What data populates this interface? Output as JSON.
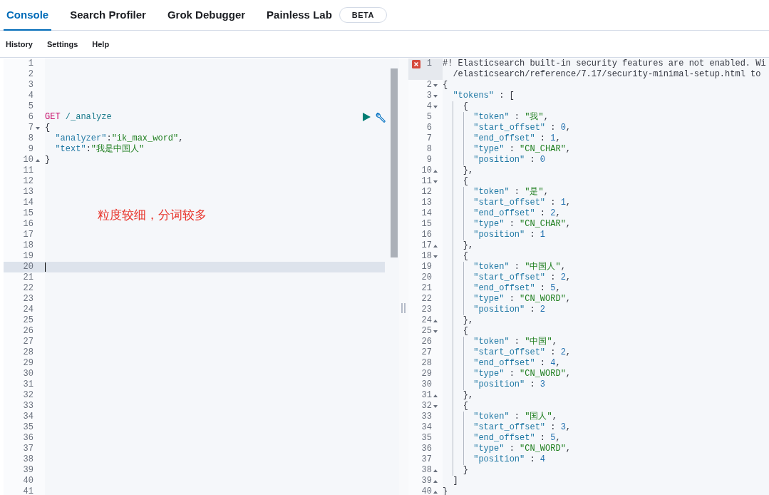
{
  "tabs": [
    {
      "label": "Console",
      "selected": true
    },
    {
      "label": "Search Profiler",
      "selected": false
    },
    {
      "label": "Grok Debugger",
      "selected": false
    },
    {
      "label": "Painless Lab",
      "selected": false,
      "badge": "BETA"
    }
  ],
  "menu": [
    "History",
    "Settings",
    "Help"
  ],
  "request_editor": {
    "annotation": "粒度较细，分词较多",
    "lines": [
      {
        "n": "1",
        "fold_start": false,
        "fold_end": false,
        "active": false,
        "actions": false
      },
      {
        "n": "2",
        "fold_start": false,
        "fold_end": false,
        "active": false,
        "actions": false
      },
      {
        "n": "3",
        "fold_start": false,
        "fold_end": false,
        "active": false,
        "actions": false
      },
      {
        "n": "4",
        "fold_start": false,
        "fold_end": false,
        "active": false,
        "actions": false
      },
      {
        "n": "5",
        "fold_start": false,
        "fold_end": false,
        "active": false,
        "actions": false
      },
      {
        "n": "6",
        "fold_start": false,
        "fold_end": false,
        "active": false,
        "actions": true,
        "tokens": [
          {
            "kind": "keyword",
            "text": "GET"
          },
          {
            "kind": "path",
            "text": " /_analyze"
          }
        ]
      },
      {
        "n": "7",
        "fold_start": true,
        "fold_end": false,
        "active": false,
        "actions": false,
        "tokens": [
          {
            "kind": "punct",
            "text": "{"
          }
        ]
      },
      {
        "n": "8",
        "fold_start": false,
        "fold_end": false,
        "active": false,
        "actions": false,
        "tokens": [
          {
            "kind": "key",
            "text": "  \"analyzer\""
          },
          {
            "kind": "punct",
            "text": ":"
          },
          {
            "kind": "string",
            "text": "\"ik_max_word\""
          },
          {
            "kind": "punct",
            "text": ","
          }
        ]
      },
      {
        "n": "9",
        "fold_start": false,
        "fold_end": false,
        "active": false,
        "actions": false,
        "tokens": [
          {
            "kind": "key",
            "text": "  \"text\""
          },
          {
            "kind": "punct",
            "text": ":"
          },
          {
            "kind": "string",
            "text": "\"我是中国人\""
          }
        ]
      },
      {
        "n": "10",
        "fold_start": false,
        "fold_end": true,
        "active": false,
        "actions": false,
        "tokens": [
          {
            "kind": "punct",
            "text": "}"
          }
        ]
      },
      {
        "n": "11",
        "fold_start": false,
        "fold_end": false,
        "active": false,
        "actions": false
      },
      {
        "n": "12",
        "fold_start": false,
        "fold_end": false,
        "active": false,
        "actions": false
      },
      {
        "n": "13",
        "fold_start": false,
        "fold_end": false,
        "active": false,
        "actions": false
      },
      {
        "n": "14",
        "fold_start": false,
        "fold_end": false,
        "active": false,
        "actions": false
      },
      {
        "n": "15",
        "fold_start": false,
        "fold_end": false,
        "active": false,
        "actions": false
      },
      {
        "n": "16",
        "fold_start": false,
        "fold_end": false,
        "active": false,
        "actions": false
      },
      {
        "n": "17",
        "fold_start": false,
        "fold_end": false,
        "active": false,
        "actions": false
      },
      {
        "n": "18",
        "fold_start": false,
        "fold_end": false,
        "active": false,
        "actions": false
      },
      {
        "n": "19",
        "fold_start": false,
        "fold_end": false,
        "active": false,
        "actions": false
      },
      {
        "n": "20",
        "fold_start": false,
        "fold_end": false,
        "active": true,
        "actions": false
      },
      {
        "n": "21",
        "fold_start": false,
        "fold_end": false,
        "active": false,
        "actions": false
      },
      {
        "n": "22",
        "fold_start": false,
        "fold_end": false,
        "active": false,
        "actions": false
      },
      {
        "n": "23",
        "fold_start": false,
        "fold_end": false,
        "active": false,
        "actions": false
      },
      {
        "n": "24",
        "fold_start": false,
        "fold_end": false,
        "active": false,
        "actions": false
      },
      {
        "n": "25",
        "fold_start": false,
        "fold_end": false,
        "active": false,
        "actions": false
      },
      {
        "n": "26",
        "fold_start": false,
        "fold_end": false,
        "active": false,
        "actions": false
      },
      {
        "n": "27",
        "fold_start": false,
        "fold_end": false,
        "active": false,
        "actions": false
      },
      {
        "n": "28",
        "fold_start": false,
        "fold_end": false,
        "active": false,
        "actions": false
      },
      {
        "n": "29",
        "fold_start": false,
        "fold_end": false,
        "active": false,
        "actions": false
      },
      {
        "n": "30",
        "fold_start": false,
        "fold_end": false,
        "active": false,
        "actions": false
      },
      {
        "n": "31",
        "fold_start": false,
        "fold_end": false,
        "active": false,
        "actions": false
      },
      {
        "n": "32",
        "fold_start": false,
        "fold_end": false,
        "active": false,
        "actions": false
      },
      {
        "n": "33",
        "fold_start": false,
        "fold_end": false,
        "active": false,
        "actions": false
      },
      {
        "n": "34",
        "fold_start": false,
        "fold_end": false,
        "active": false,
        "actions": false
      },
      {
        "n": "35",
        "fold_start": false,
        "fold_end": false,
        "active": false,
        "actions": false
      },
      {
        "n": "36",
        "fold_start": false,
        "fold_end": false,
        "active": false,
        "actions": false
      },
      {
        "n": "37",
        "fold_start": false,
        "fold_end": false,
        "active": false,
        "actions": false
      },
      {
        "n": "38",
        "fold_start": false,
        "fold_end": false,
        "active": false,
        "actions": false
      },
      {
        "n": "39",
        "fold_start": false,
        "fold_end": false,
        "active": false,
        "actions": false
      },
      {
        "n": "40",
        "fold_start": false,
        "fold_end": false,
        "active": false,
        "actions": false
      },
      {
        "n": "41",
        "fold_start": false,
        "fold_end": false,
        "active": false,
        "actions": false
      }
    ]
  },
  "response_editor": {
    "lines": [
      {
        "n": "1",
        "fold_start": false,
        "fold_end": false,
        "error": true,
        "tokens": [
          {
            "kind": "comment",
            "text": "#! Elasticsearch built-in security features are not enabled. Wi"
          }
        ],
        "continuation": "/elasticsearch/reference/7.17/security-minimal-setup.html to"
      },
      {
        "n": "2",
        "fold_start": true,
        "fold_end": false,
        "error": false,
        "tokens": [
          {
            "kind": "punct",
            "text": "{"
          }
        ]
      },
      {
        "n": "3",
        "fold_start": true,
        "fold_end": false,
        "error": false,
        "tokens": [
          {
            "kind": "key",
            "text": "  \"tokens\""
          },
          {
            "kind": "punct",
            "text": " : ["
          }
        ]
      },
      {
        "n": "4",
        "fold_start": true,
        "fold_end": false,
        "error": false,
        "tokens": [
          {
            "kind": "punct",
            "text": "    {"
          }
        ]
      },
      {
        "n": "5",
        "fold_start": false,
        "fold_end": false,
        "error": false,
        "tokens": [
          {
            "kind": "key",
            "text": "      \"token\""
          },
          {
            "kind": "punct",
            "text": " : "
          },
          {
            "kind": "string",
            "text": "\"我\""
          },
          {
            "kind": "punct",
            "text": ","
          }
        ]
      },
      {
        "n": "6",
        "fold_start": false,
        "fold_end": false,
        "error": false,
        "tokens": [
          {
            "kind": "key",
            "text": "      \"start_offset\""
          },
          {
            "kind": "punct",
            "text": " : "
          },
          {
            "kind": "number",
            "text": "0"
          },
          {
            "kind": "punct",
            "text": ","
          }
        ]
      },
      {
        "n": "7",
        "fold_start": false,
        "fold_end": false,
        "error": false,
        "tokens": [
          {
            "kind": "key",
            "text": "      \"end_offset\""
          },
          {
            "kind": "punct",
            "text": " : "
          },
          {
            "kind": "number",
            "text": "1"
          },
          {
            "kind": "punct",
            "text": ","
          }
        ]
      },
      {
        "n": "8",
        "fold_start": false,
        "fold_end": false,
        "error": false,
        "tokens": [
          {
            "kind": "key",
            "text": "      \"type\""
          },
          {
            "kind": "punct",
            "text": " : "
          },
          {
            "kind": "string",
            "text": "\"CN_CHAR\""
          },
          {
            "kind": "punct",
            "text": ","
          }
        ]
      },
      {
        "n": "9",
        "fold_start": false,
        "fold_end": false,
        "error": false,
        "tokens": [
          {
            "kind": "key",
            "text": "      \"position\""
          },
          {
            "kind": "punct",
            "text": " : "
          },
          {
            "kind": "number",
            "text": "0"
          }
        ]
      },
      {
        "n": "10",
        "fold_start": false,
        "fold_end": true,
        "error": false,
        "tokens": [
          {
            "kind": "punct",
            "text": "    },"
          }
        ]
      },
      {
        "n": "11",
        "fold_start": true,
        "fold_end": false,
        "error": false,
        "tokens": [
          {
            "kind": "punct",
            "text": "    {"
          }
        ]
      },
      {
        "n": "12",
        "fold_start": false,
        "fold_end": false,
        "error": false,
        "tokens": [
          {
            "kind": "key",
            "text": "      \"token\""
          },
          {
            "kind": "punct",
            "text": " : "
          },
          {
            "kind": "string",
            "text": "\"是\""
          },
          {
            "kind": "punct",
            "text": ","
          }
        ]
      },
      {
        "n": "13",
        "fold_start": false,
        "fold_end": false,
        "error": false,
        "tokens": [
          {
            "kind": "key",
            "text": "      \"start_offset\""
          },
          {
            "kind": "punct",
            "text": " : "
          },
          {
            "kind": "number",
            "text": "1"
          },
          {
            "kind": "punct",
            "text": ","
          }
        ]
      },
      {
        "n": "14",
        "fold_start": false,
        "fold_end": false,
        "error": false,
        "tokens": [
          {
            "kind": "key",
            "text": "      \"end_offset\""
          },
          {
            "kind": "punct",
            "text": " : "
          },
          {
            "kind": "number",
            "text": "2"
          },
          {
            "kind": "punct",
            "text": ","
          }
        ]
      },
      {
        "n": "15",
        "fold_start": false,
        "fold_end": false,
        "error": false,
        "tokens": [
          {
            "kind": "key",
            "text": "      \"type\""
          },
          {
            "kind": "punct",
            "text": " : "
          },
          {
            "kind": "string",
            "text": "\"CN_CHAR\""
          },
          {
            "kind": "punct",
            "text": ","
          }
        ]
      },
      {
        "n": "16",
        "fold_start": false,
        "fold_end": false,
        "error": false,
        "tokens": [
          {
            "kind": "key",
            "text": "      \"position\""
          },
          {
            "kind": "punct",
            "text": " : "
          },
          {
            "kind": "number",
            "text": "1"
          }
        ]
      },
      {
        "n": "17",
        "fold_start": false,
        "fold_end": true,
        "error": false,
        "tokens": [
          {
            "kind": "punct",
            "text": "    },"
          }
        ]
      },
      {
        "n": "18",
        "fold_start": true,
        "fold_end": false,
        "error": false,
        "tokens": [
          {
            "kind": "punct",
            "text": "    {"
          }
        ]
      },
      {
        "n": "19",
        "fold_start": false,
        "fold_end": false,
        "error": false,
        "tokens": [
          {
            "kind": "key",
            "text": "      \"token\""
          },
          {
            "kind": "punct",
            "text": " : "
          },
          {
            "kind": "string",
            "text": "\"中国人\""
          },
          {
            "kind": "punct",
            "text": ","
          }
        ]
      },
      {
        "n": "20",
        "fold_start": false,
        "fold_end": false,
        "error": false,
        "tokens": [
          {
            "kind": "key",
            "text": "      \"start_offset\""
          },
          {
            "kind": "punct",
            "text": " : "
          },
          {
            "kind": "number",
            "text": "2"
          },
          {
            "kind": "punct",
            "text": ","
          }
        ]
      },
      {
        "n": "21",
        "fold_start": false,
        "fold_end": false,
        "error": false,
        "tokens": [
          {
            "kind": "key",
            "text": "      \"end_offset\""
          },
          {
            "kind": "punct",
            "text": " : "
          },
          {
            "kind": "number",
            "text": "5"
          },
          {
            "kind": "punct",
            "text": ","
          }
        ]
      },
      {
        "n": "22",
        "fold_start": false,
        "fold_end": false,
        "error": false,
        "tokens": [
          {
            "kind": "key",
            "text": "      \"type\""
          },
          {
            "kind": "punct",
            "text": " : "
          },
          {
            "kind": "string",
            "text": "\"CN_WORD\""
          },
          {
            "kind": "punct",
            "text": ","
          }
        ]
      },
      {
        "n": "23",
        "fold_start": false,
        "fold_end": false,
        "error": false,
        "tokens": [
          {
            "kind": "key",
            "text": "      \"position\""
          },
          {
            "kind": "punct",
            "text": " : "
          },
          {
            "kind": "number",
            "text": "2"
          }
        ]
      },
      {
        "n": "24",
        "fold_start": false,
        "fold_end": true,
        "error": false,
        "tokens": [
          {
            "kind": "punct",
            "text": "    },"
          }
        ]
      },
      {
        "n": "25",
        "fold_start": true,
        "fold_end": false,
        "error": false,
        "tokens": [
          {
            "kind": "punct",
            "text": "    {"
          }
        ]
      },
      {
        "n": "26",
        "fold_start": false,
        "fold_end": false,
        "error": false,
        "tokens": [
          {
            "kind": "key",
            "text": "      \"token\""
          },
          {
            "kind": "punct",
            "text": " : "
          },
          {
            "kind": "string",
            "text": "\"中国\""
          },
          {
            "kind": "punct",
            "text": ","
          }
        ]
      },
      {
        "n": "27",
        "fold_start": false,
        "fold_end": false,
        "error": false,
        "tokens": [
          {
            "kind": "key",
            "text": "      \"start_offset\""
          },
          {
            "kind": "punct",
            "text": " : "
          },
          {
            "kind": "number",
            "text": "2"
          },
          {
            "kind": "punct",
            "text": ","
          }
        ]
      },
      {
        "n": "28",
        "fold_start": false,
        "fold_end": false,
        "error": false,
        "tokens": [
          {
            "kind": "key",
            "text": "      \"end_offset\""
          },
          {
            "kind": "punct",
            "text": " : "
          },
          {
            "kind": "number",
            "text": "4"
          },
          {
            "kind": "punct",
            "text": ","
          }
        ]
      },
      {
        "n": "29",
        "fold_start": false,
        "fold_end": false,
        "error": false,
        "tokens": [
          {
            "kind": "key",
            "text": "      \"type\""
          },
          {
            "kind": "punct",
            "text": " : "
          },
          {
            "kind": "string",
            "text": "\"CN_WORD\""
          },
          {
            "kind": "punct",
            "text": ","
          }
        ]
      },
      {
        "n": "30",
        "fold_start": false,
        "fold_end": false,
        "error": false,
        "tokens": [
          {
            "kind": "key",
            "text": "      \"position\""
          },
          {
            "kind": "punct",
            "text": " : "
          },
          {
            "kind": "number",
            "text": "3"
          }
        ]
      },
      {
        "n": "31",
        "fold_start": false,
        "fold_end": true,
        "error": false,
        "tokens": [
          {
            "kind": "punct",
            "text": "    },"
          }
        ]
      },
      {
        "n": "32",
        "fold_start": true,
        "fold_end": false,
        "error": false,
        "tokens": [
          {
            "kind": "punct",
            "text": "    {"
          }
        ]
      },
      {
        "n": "33",
        "fold_start": false,
        "fold_end": false,
        "error": false,
        "tokens": [
          {
            "kind": "key",
            "text": "      \"token\""
          },
          {
            "kind": "punct",
            "text": " : "
          },
          {
            "kind": "string",
            "text": "\"国人\""
          },
          {
            "kind": "punct",
            "text": ","
          }
        ]
      },
      {
        "n": "34",
        "fold_start": false,
        "fold_end": false,
        "error": false,
        "tokens": [
          {
            "kind": "key",
            "text": "      \"start_offset\""
          },
          {
            "kind": "punct",
            "text": " : "
          },
          {
            "kind": "number",
            "text": "3"
          },
          {
            "kind": "punct",
            "text": ","
          }
        ]
      },
      {
        "n": "35",
        "fold_start": false,
        "fold_end": false,
        "error": false,
        "tokens": [
          {
            "kind": "key",
            "text": "      \"end_offset\""
          },
          {
            "kind": "punct",
            "text": " : "
          },
          {
            "kind": "number",
            "text": "5"
          },
          {
            "kind": "punct",
            "text": ","
          }
        ]
      },
      {
        "n": "36",
        "fold_start": false,
        "fold_end": false,
        "error": false,
        "tokens": [
          {
            "kind": "key",
            "text": "      \"type\""
          },
          {
            "kind": "punct",
            "text": " : "
          },
          {
            "kind": "string",
            "text": "\"CN_WORD\""
          },
          {
            "kind": "punct",
            "text": ","
          }
        ]
      },
      {
        "n": "37",
        "fold_start": false,
        "fold_end": false,
        "error": false,
        "tokens": [
          {
            "kind": "key",
            "text": "      \"position\""
          },
          {
            "kind": "punct",
            "text": " : "
          },
          {
            "kind": "number",
            "text": "4"
          }
        ]
      },
      {
        "n": "38",
        "fold_start": false,
        "fold_end": true,
        "error": false,
        "tokens": [
          {
            "kind": "punct",
            "text": "    }"
          }
        ]
      },
      {
        "n": "39",
        "fold_start": false,
        "fold_end": true,
        "error": false,
        "tokens": [
          {
            "kind": "punct",
            "text": "  ]"
          }
        ]
      },
      {
        "n": "40",
        "fold_start": false,
        "fold_end": true,
        "error": false,
        "tokens": [
          {
            "kind": "punct",
            "text": "}"
          }
        ]
      }
    ]
  }
}
